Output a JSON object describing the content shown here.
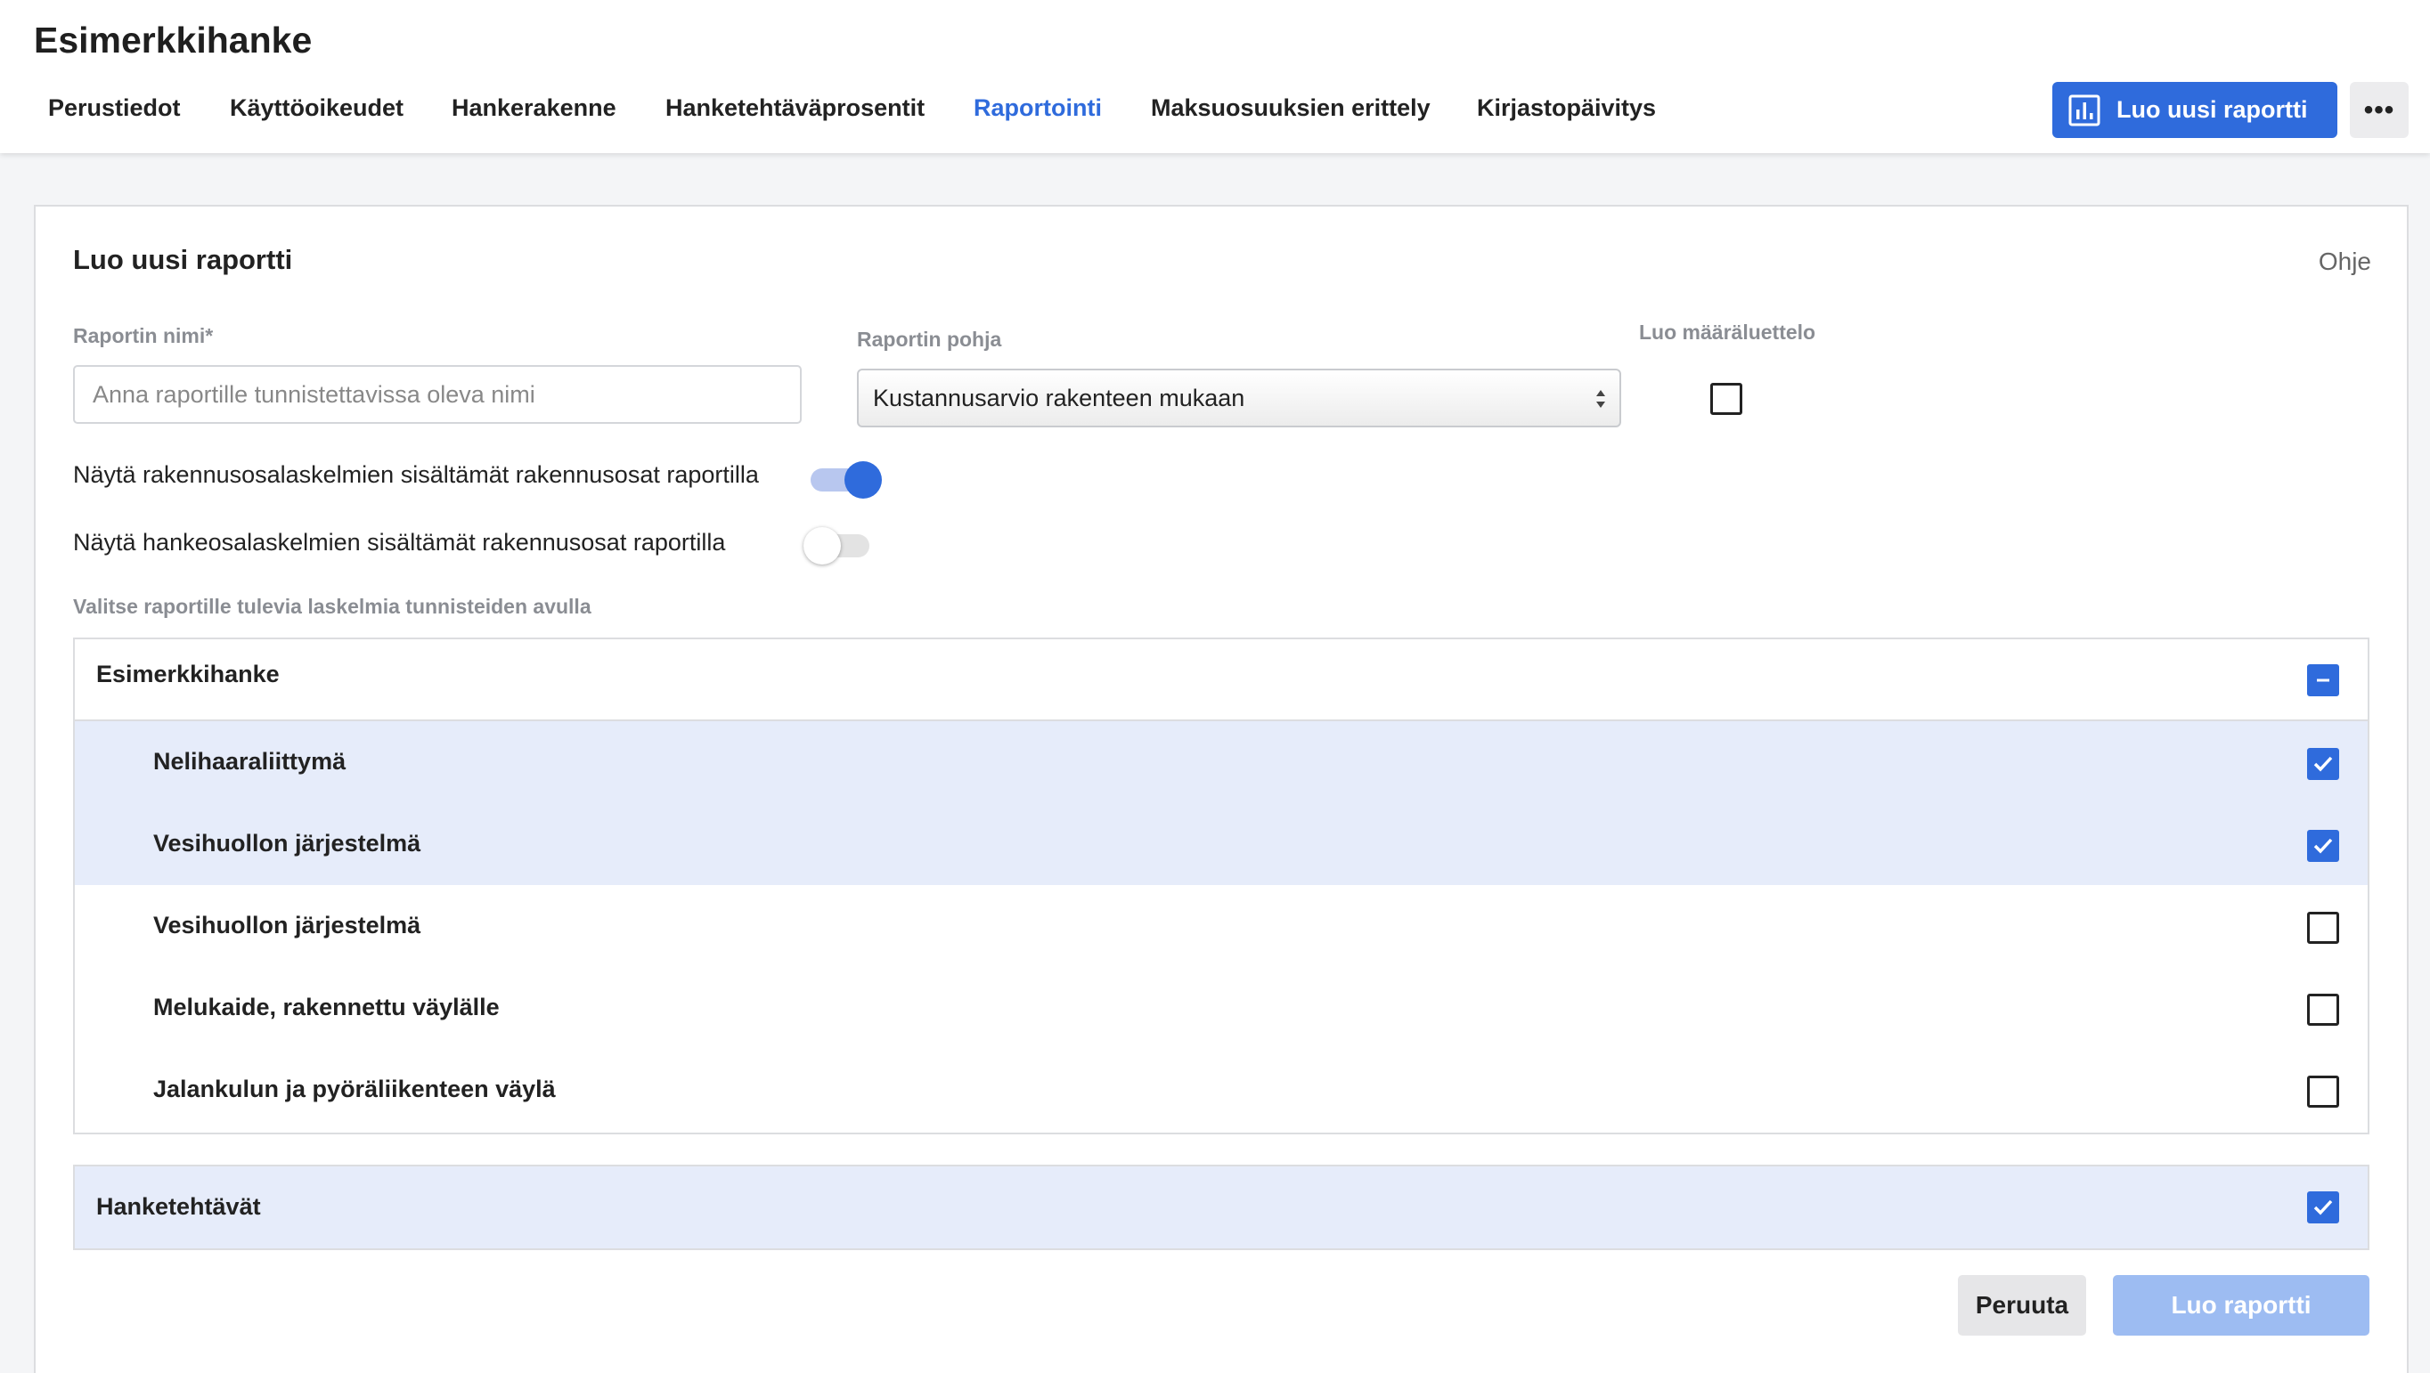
{
  "header": {
    "project_title": "Esimerkkihanke",
    "tabs": [
      {
        "label": "Perustiedot",
        "active": false
      },
      {
        "label": "Käyttöoikeudet",
        "active": false
      },
      {
        "label": "Hankerakenne",
        "active": false
      },
      {
        "label": "Hanketehtäväprosentit",
        "active": false
      },
      {
        "label": "Raportointi",
        "active": true
      },
      {
        "label": "Maksuosuuksien erittely",
        "active": false
      },
      {
        "label": "Kirjastopäivitys",
        "active": false
      }
    ],
    "new_report_button": "Luo uusi raportti",
    "more_button": "•••",
    "accent_color": "#2f6bdc"
  },
  "form": {
    "title": "Luo uusi raportti",
    "help_link": "Ohje",
    "name_label": "Raportin nimi*",
    "name_value": "",
    "name_placeholder": "Anna raportille tunnistettavissa oleva nimi",
    "template_label": "Raportin pohja",
    "template_value": "Kustannusarvio rakenteen mukaan",
    "quantity_list_label": "Luo määräluettelo",
    "quantity_list_checked": false,
    "toggle_building_parts_label": "Näytä rakennusosalaskelmien sisältämät rakennusosat raportilla",
    "toggle_building_parts_on": true,
    "toggle_project_parts_label": "Näytä hankeosalaskelmien sisältämät rakennusosat raportilla",
    "toggle_project_parts_on": false,
    "selection_hint": "Valitse raportille tulevia laskelmia tunnisteiden avulla",
    "tree": {
      "root": {
        "label": "Esimerkkihanke",
        "state": "partial"
      },
      "items": [
        {
          "label": "Nelihaaraliittymä",
          "checked": true
        },
        {
          "label": "Vesihuollon järjestelmä",
          "checked": true
        },
        {
          "label": "Vesihuollon järjestelmä",
          "checked": false
        },
        {
          "label": "Melukaide, rakennettu väylälle",
          "checked": false
        },
        {
          "label": "Jalankulun ja pyöräliikenteen väylä",
          "checked": false
        }
      ]
    },
    "group": {
      "label": "Hanketehtävät",
      "checked": true
    },
    "cancel_button": "Peruuta",
    "create_button": "Luo raportti"
  }
}
